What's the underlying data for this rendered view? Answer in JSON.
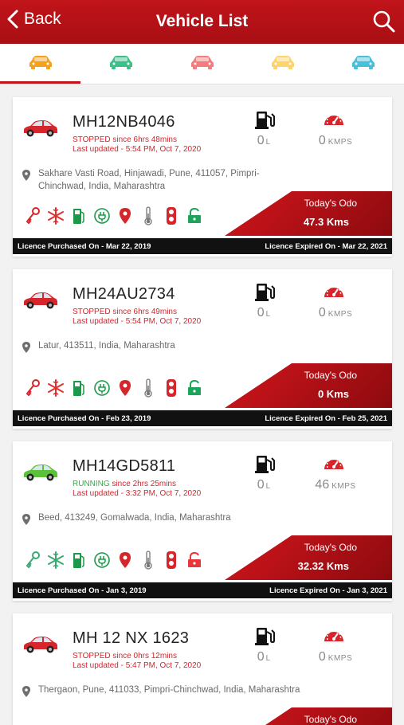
{
  "header": {
    "back_label": "Back",
    "title": "Vehicle List"
  },
  "tabs": [
    {
      "name": "all",
      "color": "#f4a11c"
    },
    {
      "name": "running",
      "color": "#3dbf8a"
    },
    {
      "name": "stopped",
      "color": "#f47c7c"
    },
    {
      "name": "idle",
      "color": "#ffd36b"
    },
    {
      "name": "inactive",
      "color": "#47c1d9"
    }
  ],
  "vehicles": [
    {
      "plate": "MH12NB4046",
      "status_word": "STOPPED",
      "status_rest": " since 6hrs 48mins",
      "updated": "Last updated - 5:54 PM, Oct 7, 2020",
      "fuel_value": "0",
      "fuel_unit": "L",
      "speed_value": "0",
      "speed_unit": "KMPS",
      "address": "Sakhare Vasti Road, Hinjawadi, Pune, 411057, Pimpri-Chinchwad, India, Maharashtra",
      "odo_label": "Today's Odo",
      "odo_value": "47.3 Kms",
      "licence_purchased": "Licence Purchased On - Mar 22, 2019",
      "licence_expired": "Licence Expired On - Mar 22, 2021",
      "car_color": "#d4262b"
    },
    {
      "plate": "MH24AU2734",
      "status_word": "STOPPED",
      "status_rest": " since 6hrs 49mins",
      "updated": "Last updated - 5:54 PM, Oct 7, 2020",
      "fuel_value": "0",
      "fuel_unit": "L",
      "speed_value": "0",
      "speed_unit": "KMPS",
      "address": "Latur, 413511, India, Maharashtra",
      "odo_label": "Today's Odo",
      "odo_value": "0 Kms",
      "licence_purchased": "Licence Purchased On - Feb 23, 2019",
      "licence_expired": "Licence Expired On - Feb 25, 2021",
      "car_color": "#d4262b"
    },
    {
      "plate": "MH14GD5811",
      "status_word": "RUNNING",
      "status_rest": " since 2hrs 25mins",
      "updated": "Last updated - 3:32 PM, Oct 7, 2020",
      "fuel_value": "0",
      "fuel_unit": "L",
      "speed_value": "46",
      "speed_unit": "KMPS",
      "address": "Beed, 413249, Gomalwada, India, Maharashtra",
      "odo_label": "Today's Odo",
      "odo_value": "32.32 Kms",
      "licence_purchased": "Licence Purchased On - Jan 3, 2019",
      "licence_expired": "Licence Expired On - Jan 3, 2021",
      "car_color": "#5cc13a"
    },
    {
      "plate": "MH 12 NX 1623",
      "status_word": "STOPPED",
      "status_rest": " since 0hrs 12mins",
      "updated": "Last updated - 5:47 PM, Oct 7, 2020",
      "fuel_value": "0",
      "fuel_unit": "L",
      "speed_value": "0",
      "speed_unit": "KMPS",
      "address": "Thergaon, Pune, 411033, Pimpri-Chinchwad, India, Maharashtra",
      "odo_label": "Today's Odo",
      "odo_value": "",
      "licence_purchased": "",
      "licence_expired": "",
      "car_color": "#d4262b"
    }
  ],
  "colors": {
    "accent": "#c0141a",
    "stopped": "#d8232a",
    "running": "#3aa94a"
  }
}
